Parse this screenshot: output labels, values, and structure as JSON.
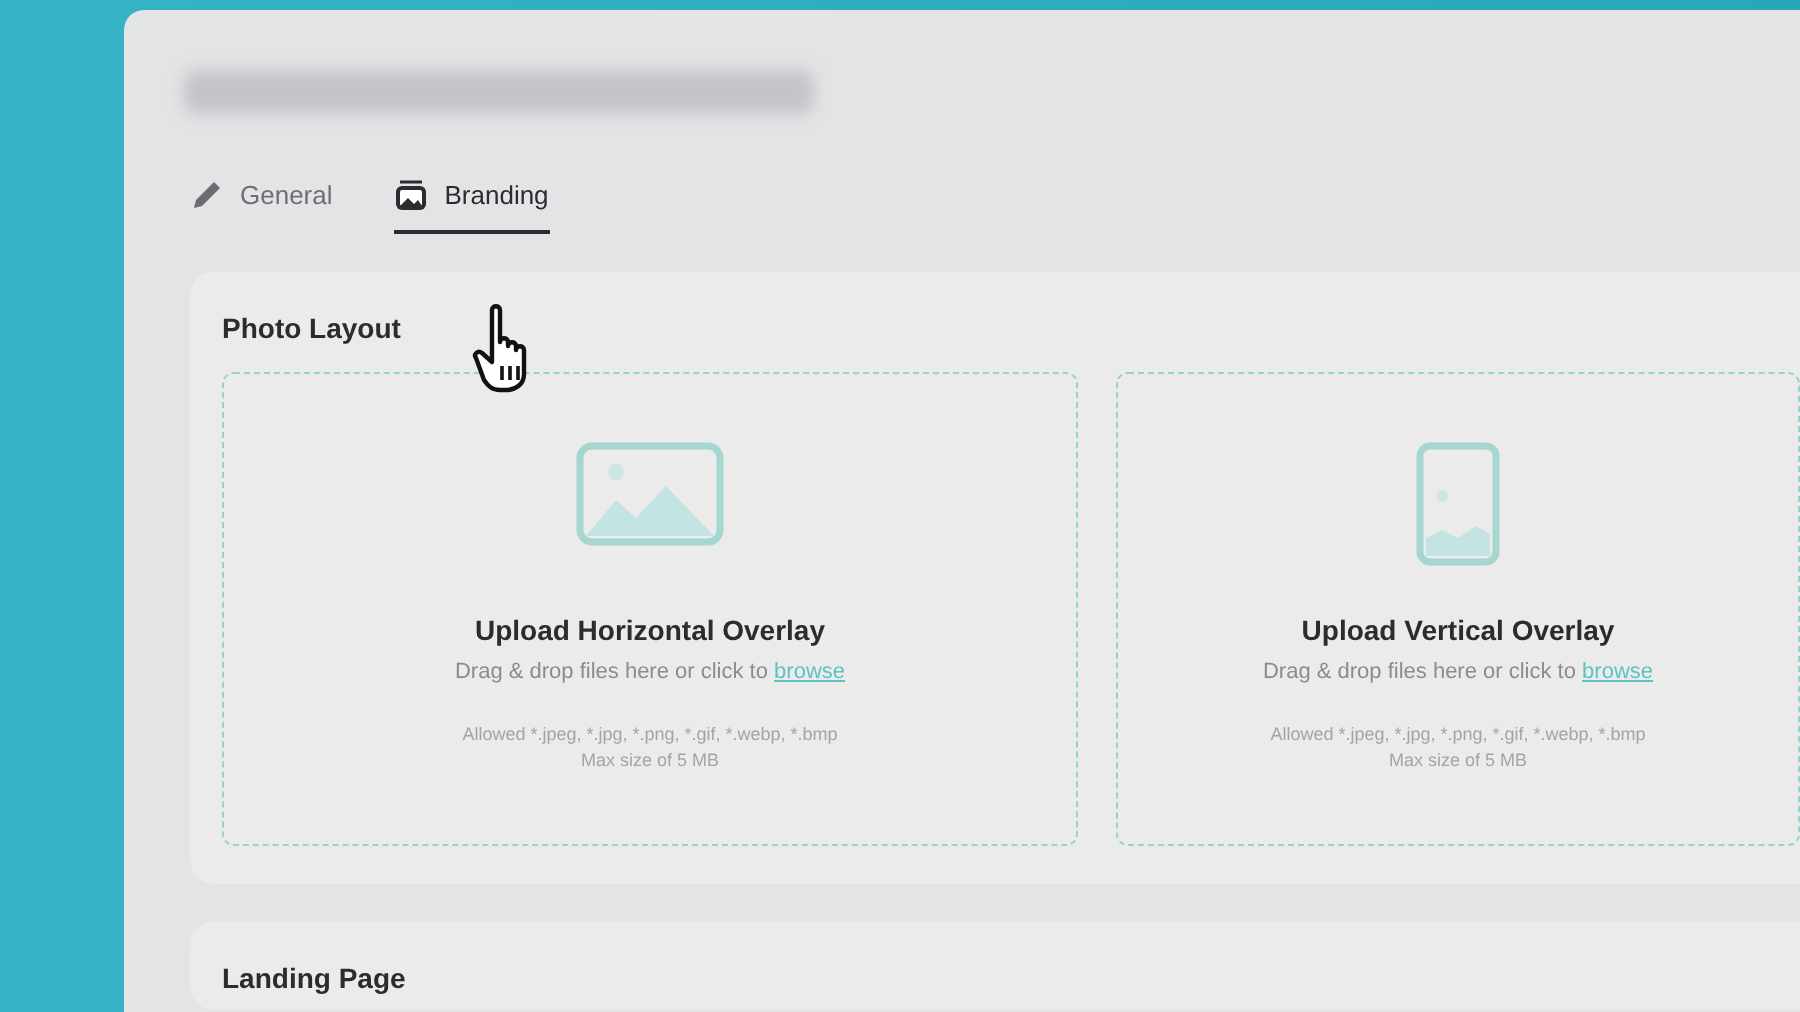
{
  "tabs": [
    {
      "label": "General",
      "selected": false
    },
    {
      "label": "Branding",
      "selected": true
    }
  ],
  "sections": [
    {
      "title": "Photo Layout",
      "dropzones": [
        {
          "kind": "horizontal",
          "title": "Upload Horizontal Overlay",
          "prompt": "Drag & drop files here or click to",
          "link": "browse",
          "allowed": "Allowed *.jpeg, *.jpg, *.png, *.gif, *.webp, *.bmp",
          "max_size": "Max size of 5 MB"
        },
        {
          "kind": "vertical",
          "title": "Upload Vertical Overlay",
          "prompt": "Drag & drop files here or click to",
          "link": "browse",
          "allowed": "Allowed *.jpeg, *.jpg, *.png, *.gif, *.webp, *.bmp",
          "max_size": "Max size of 5 MB"
        }
      ]
    },
    {
      "title": "Landing Page"
    }
  ]
}
